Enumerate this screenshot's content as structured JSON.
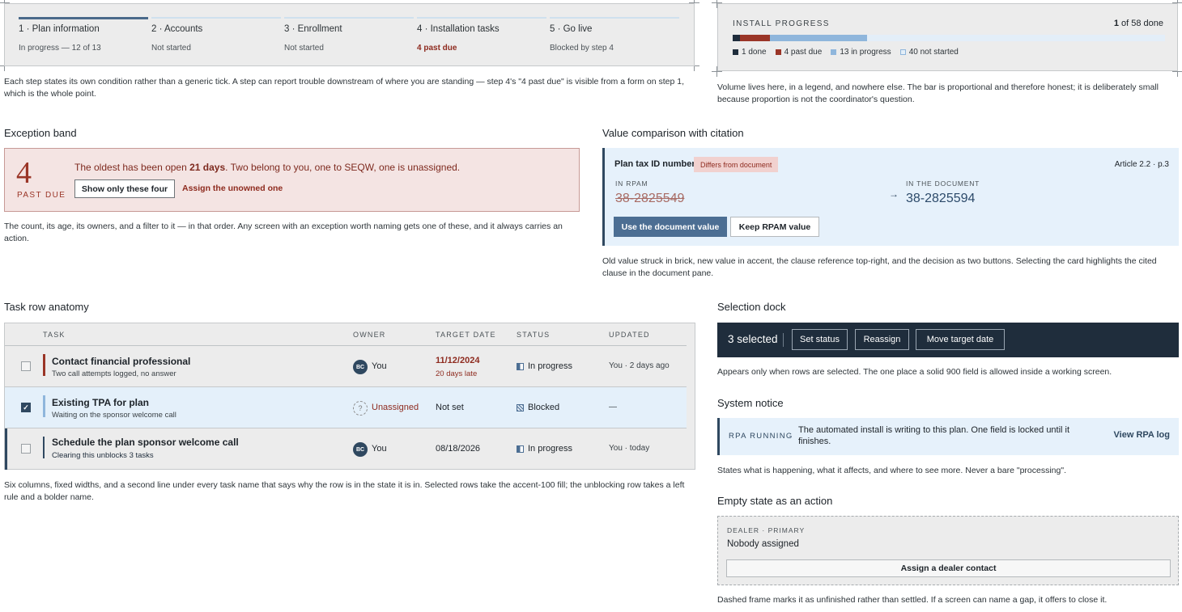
{
  "stepper": {
    "steps": [
      {
        "label": "1 · Plan information",
        "sub": "In progress — 12 of 13"
      },
      {
        "label": "2 · Accounts",
        "sub": "Not started"
      },
      {
        "label": "3 · Enrollment",
        "sub": "Not started"
      },
      {
        "label": "4 · Installation tasks",
        "sub": "4 past due"
      },
      {
        "label": "5 · Go live",
        "sub": "Blocked by step 4"
      }
    ],
    "caption": "Each step states its own condition rather than a generic tick. A step can report trouble downstream of where you are standing — step 4's \"4 past due\" is visible from a form on step 1, which is the whole point."
  },
  "install_progress": {
    "title": "INSTALL PROGRESS",
    "count_done": "1",
    "count_rest": "of 58 done",
    "segments": [
      {
        "label": "1 done",
        "value": 1,
        "color": "#1f2d3c"
      },
      {
        "label": "4 past due",
        "value": 4,
        "color": "#9a3527"
      },
      {
        "label": "13 in progress",
        "value": 13,
        "color": "#8fb6dc"
      },
      {
        "label": "40 not started",
        "value": 40,
        "color": "#e3eef8"
      }
    ],
    "total": 58,
    "caption": "Volume lives here, in a legend, and nowhere else. The bar is proportional and therefore honest; it is deliberately small because proportion is not the coordinator's question."
  },
  "exception_band": {
    "section_title": "Exception band",
    "count": "4",
    "label": "PAST DUE",
    "text_pre": "The oldest has been open ",
    "text_bold": "21 days",
    "text_post": ". Two belong to you, one to SEQW, one is unassigned.",
    "filter_button": "Show only these four",
    "assign_link": "Assign the unowned one",
    "caption": "The count, its age, its owners, and a filter to it — in that order. Any screen with an exception worth naming gets one of these, and it always carries an action."
  },
  "value_comparison": {
    "section_title": "Value comparison with citation",
    "field": "Plan tax ID number",
    "badge": "Differs from document",
    "citation": "Article 2.2 · p.3",
    "old_label": "IN RPAM",
    "old_value": "38-2825549",
    "arrow": "→",
    "new_label": "IN THE DOCUMENT",
    "new_value": "38-2825594",
    "use_button": "Use the document value",
    "keep_button": "Keep RPAM value",
    "caption": "Old value struck in brick, new value in accent, the clause reference top-right, and the decision as two buttons. Selecting the card highlights the cited clause in the document pane."
  },
  "task_table": {
    "section_title": "Task row anatomy",
    "headers": {
      "task": "TASK",
      "owner": "OWNER",
      "target": "TARGET DATE",
      "status": "STATUS",
      "updated": "UPDATED"
    },
    "rows": [
      {
        "name": "Contact financial professional",
        "sub": "Two call attempts logged, no answer",
        "initials": "BC",
        "owner": "You",
        "target": "11/12/2024",
        "target_sub": "20 days late",
        "status": "In progress",
        "updated": "You · 2 days ago"
      },
      {
        "name": "Existing TPA for plan",
        "sub": "Waiting on the sponsor welcome call",
        "initials": "?",
        "owner": "Unassigned",
        "target": "Not set",
        "target_sub": "",
        "status": "Blocked",
        "updated": "—"
      },
      {
        "name": "Schedule the plan sponsor welcome call",
        "sub": "Clearing this unblocks 3 tasks",
        "initials": "BC",
        "owner": "You",
        "target": "08/18/2026",
        "target_sub": "",
        "status": "In progress",
        "updated": "You · today"
      }
    ],
    "check_mark": "✓",
    "caption": "Six columns, fixed widths, and a second line under every task name that says why the row is in the state it is in. Selected rows take the accent-100 fill; the unblocking row takes a left rule and a bolder name."
  },
  "selection_dock": {
    "section_title": "Selection dock",
    "count": "3 selected",
    "buttons": [
      "Set status",
      "Reassign",
      "Move target date"
    ],
    "caption": "Appears only when rows are selected. The one place a solid 900 field is allowed inside a working screen."
  },
  "system_notice": {
    "section_title": "System notice",
    "tag": "RPA RUNNING",
    "text": "The automated install is writing to this plan. One field is locked until it finishes.",
    "link": "View RPA log",
    "caption": "States what is happening, what it affects, and where to see more. Never a bare \"processing\"."
  },
  "empty_state": {
    "section_title": "Empty state as an action",
    "tag": "DEALER · PRIMARY",
    "text": "Nobody assigned",
    "button": "Assign a dealer contact",
    "caption": "Dashed frame marks it as unfinished rather than settled. If a screen can name a gap, it offers to close it."
  },
  "colors": {
    "accent": "#4c6e93",
    "navy": "#1f2d3c",
    "brick": "#9a3527",
    "accent_100": "#e6f1fb"
  }
}
